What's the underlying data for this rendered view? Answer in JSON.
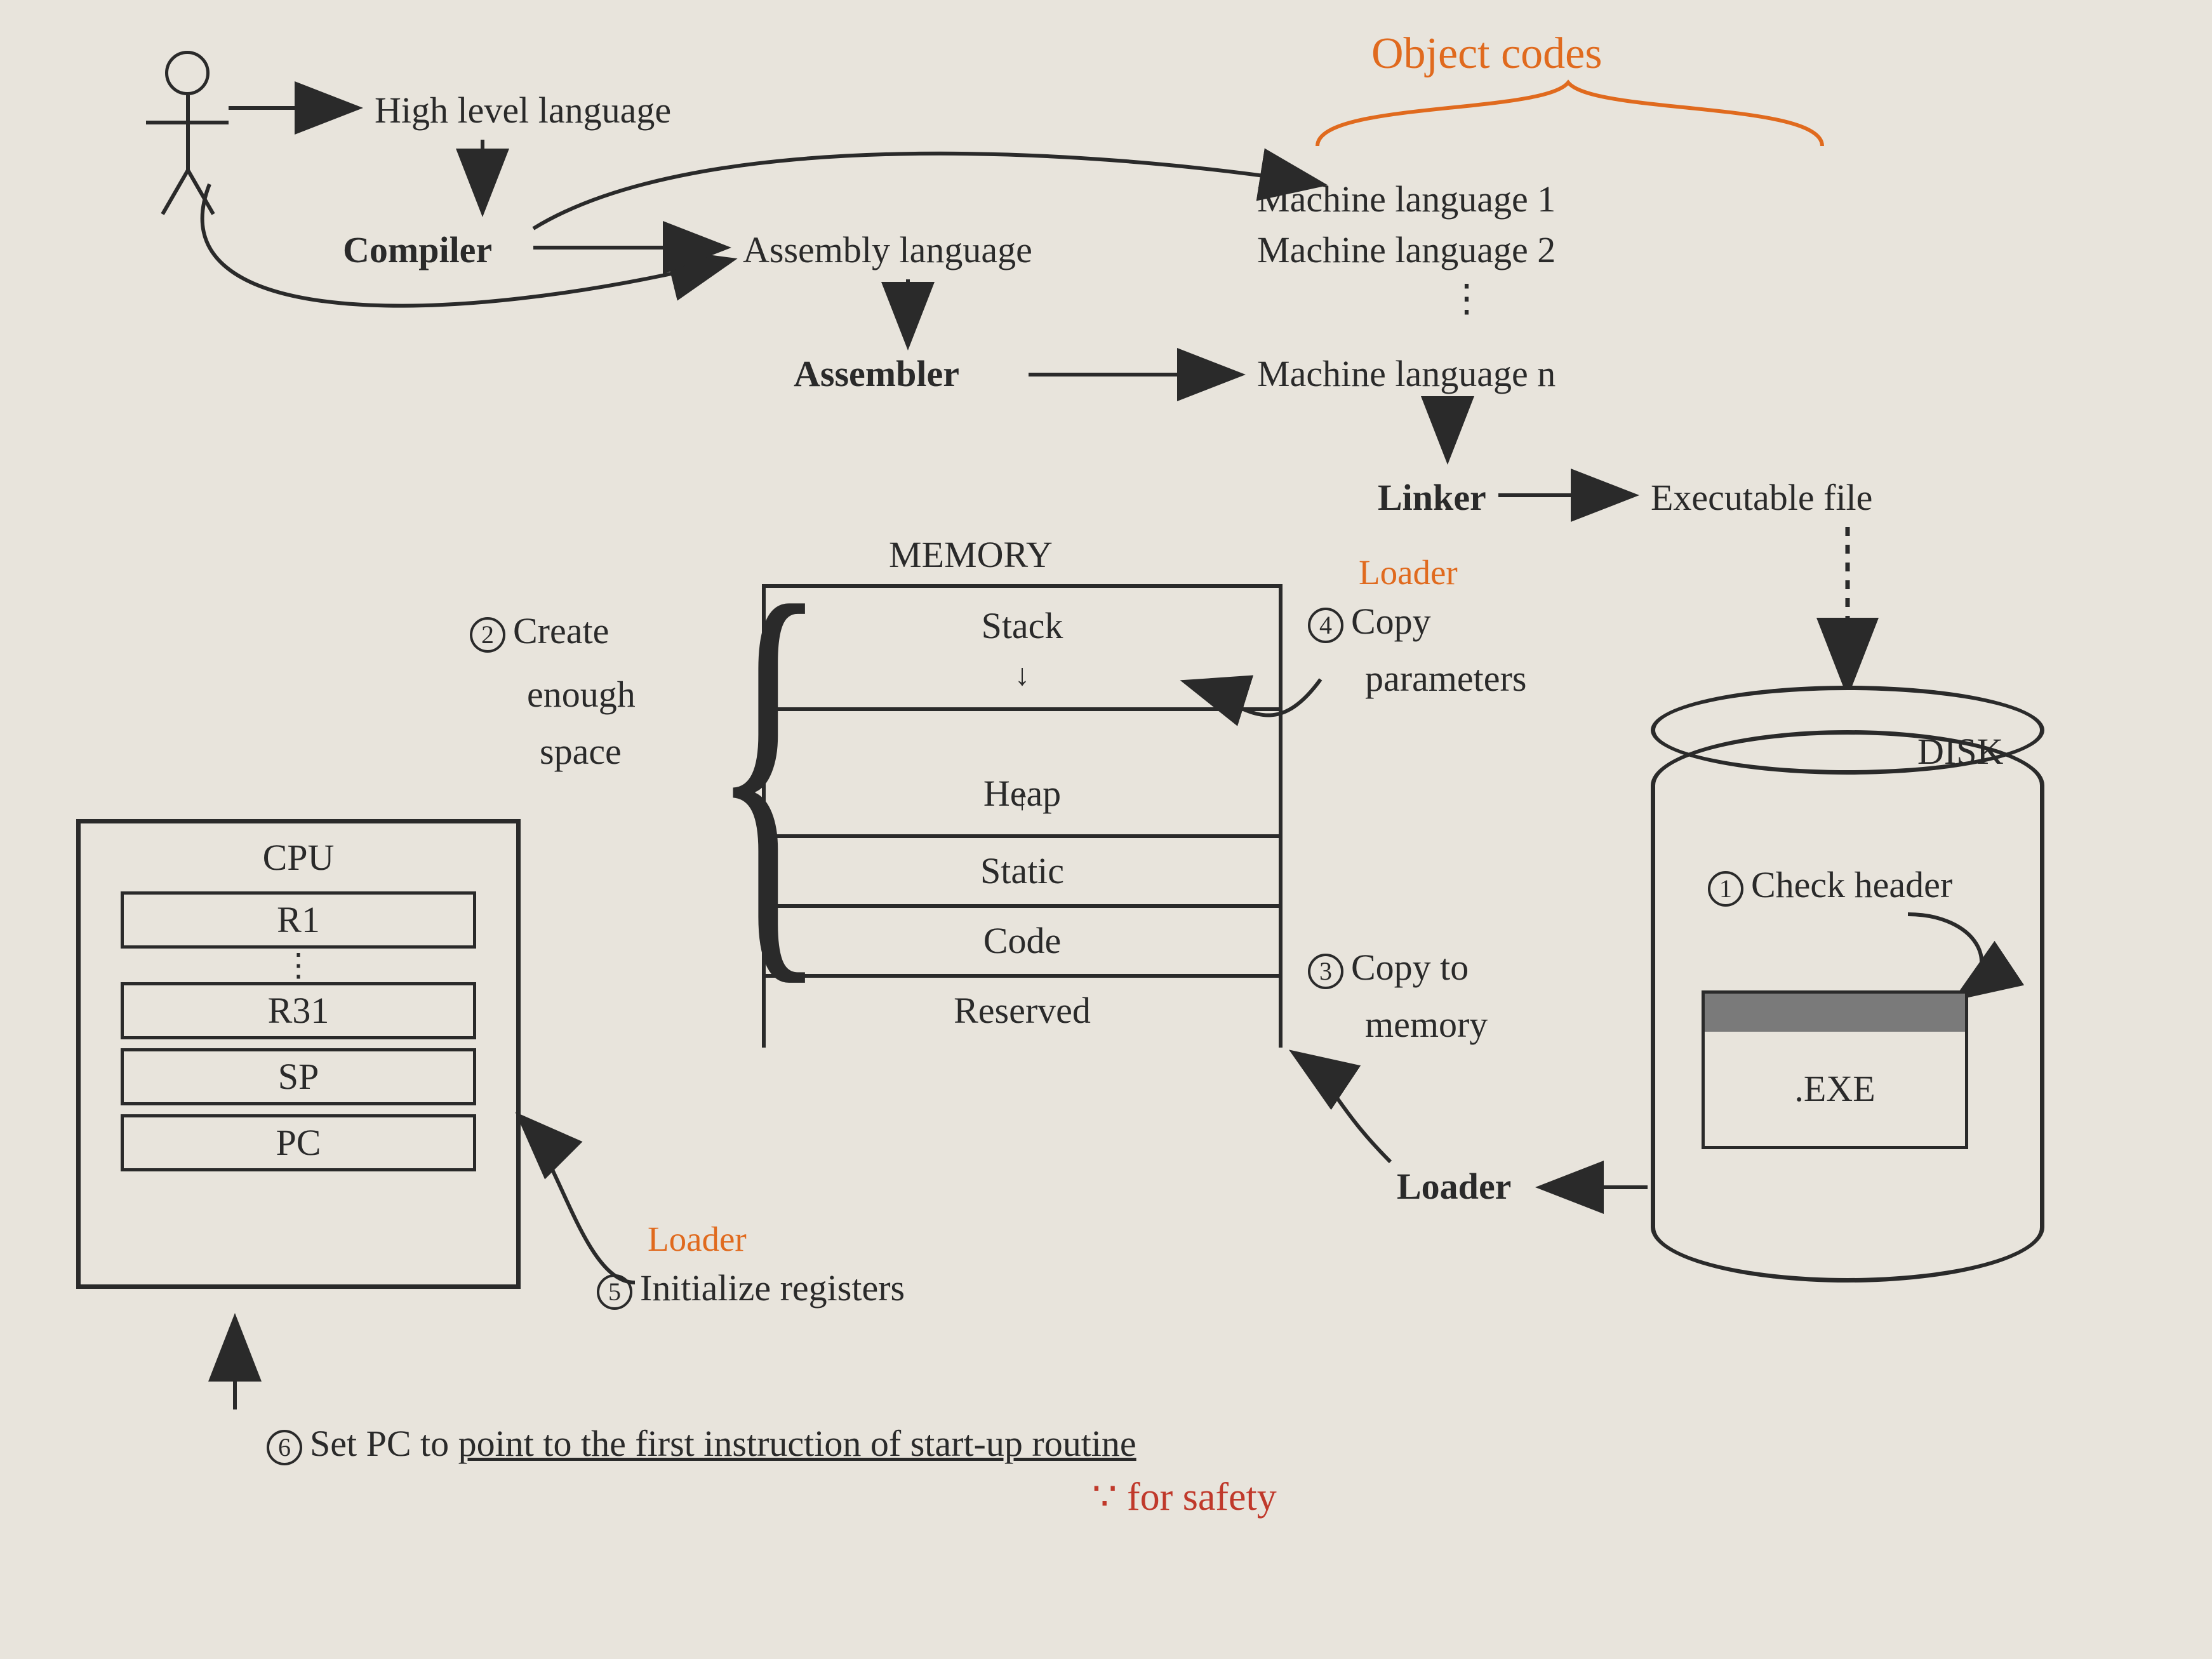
{
  "top": {
    "hll": "High level language",
    "compiler": "Compiler",
    "assembly": "Assembly language",
    "assembler": "Assembler",
    "ml1": "Machine language 1",
    "ml2": "Machine language 2",
    "mln": "Machine language n",
    "linker": "Linker",
    "exefile": "Executable file",
    "object_codes": "Object codes"
  },
  "steps": {
    "s1": "Check header",
    "s2a": "Create",
    "s2b": "enough",
    "s2c": "space",
    "s3a": "Copy to",
    "s3b": "memory",
    "s4a": "Copy",
    "s4b": "parameters",
    "s5": "Initialize registers",
    "s6": "Set PC to point to the first instruction of start-up routine"
  },
  "annot": {
    "loader1": "Loader",
    "loader2": "Loader",
    "loader3": "Loader",
    "for_safety": "∵ for safety"
  },
  "memory": {
    "title": "MEMORY",
    "rows": [
      "Stack",
      "Heap",
      "Static",
      "Code",
      "Reserved"
    ]
  },
  "cpu": {
    "title": "CPU",
    "regs": [
      "R1",
      "R31",
      "SP",
      "PC"
    ]
  },
  "disk": {
    "title": "DISK",
    "exe": ".EXE"
  },
  "nums": {
    "n1": "1",
    "n2": "2",
    "n3": "3",
    "n4": "4",
    "n5": "5",
    "n6": "6"
  }
}
